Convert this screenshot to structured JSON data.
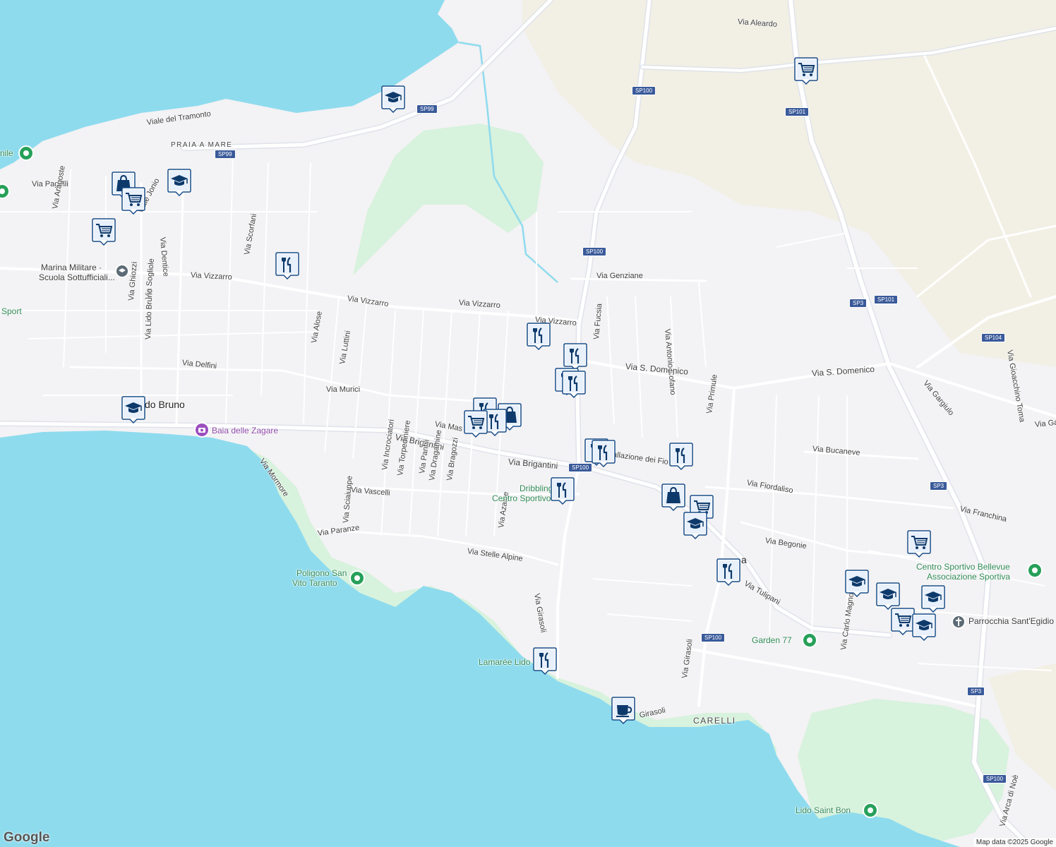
{
  "colors": {
    "land": "#f3f2f4",
    "water": "#8edbee",
    "park": "#d7f2dd",
    "farmland": "#f2efe4",
    "road": "#ffffff",
    "major_road": "#dfe3ea",
    "marker_fill": "#ffffff",
    "marker_border": "#1a4f8a",
    "marker_icon": "#0e3a6b",
    "poi_green": "#27a05a",
    "poi_purple": "#9b4fbf",
    "poi_gray": "#5d6b76"
  },
  "streets": {
    "via_aleardo": "Via Aleardo",
    "viale_del_tramonto": "Viale del Tramonto",
    "via_pagelli": "Via Pagelli",
    "via_aragoste": "Via Aragoste",
    "viale_jonio": "Viale Jonio",
    "via_dentice": "Via Dentice",
    "via_scorfani": "Via Scorfani",
    "via_vizzarro_1": "Via Vizzarro",
    "via_vizzarro_2": "Via Vizzarro",
    "via_vizzarro_3": "Via Vizzarro",
    "via_vizzarro_4": "Via Vizzarro",
    "via_ghiozzi": "Via Ghiozzi",
    "via_sogliole": "Via Sogliole",
    "via_lido_bruno": "Via Lido Bruno",
    "via_alose": "Via Alose",
    "via_luttini": "Via Luttini",
    "via_delfini": "Via Delfini",
    "via_murici": "Via Murici",
    "via_genziane": "Via Genziane",
    "via_fucsia": "Via Fucsia",
    "via_antonio_cofano": "Via Antonio Cofano",
    "via_s_domenico_1": "Via S. Domenico",
    "via_s_domenico_2": "Via S. Domenico",
    "via_primule": "Via Primule",
    "via_gargiulo": "Via Gargiulo",
    "via_gioacchino_toma": "Via Gioacchino Toma",
    "via_ga": "Via Ga",
    "via_bucaneve": "Via Bucaneve",
    "via_mas": "Via Mas",
    "via_brigantini_1": "Via Brigantini",
    "via_brigantini_2": "Via Brigantini",
    "vallazione_dei_fio": "allazione dei Fio",
    "via_fiordaliso": "Via Fiordaliso",
    "via_franchina": "Via Franchina",
    "via_mormore": "Via Mormore",
    "via_incrociatori": "Via Incrociatori",
    "via_torpediniere": "Via Torpediniere",
    "via_panfili": "Via Panfili",
    "via_dragamine": "Via Dragamine",
    "via_bragozzi": "Via Bragozzi",
    "via_vascelli": "Via Vascelli",
    "via_sciaiuppe": "Via Sciaiuppe",
    "via_paranze": "Via Paranze",
    "via_azalee": "Via Azalee",
    "via_stelle_alpine": "Via Stelle Alpine",
    "via_girasoli_1": "Via Girasoli",
    "via_girasoli_2": "Via Girasoli",
    "via_girasoli_3": "Girasoli",
    "via_begonie": "Via Begonie",
    "via_tulipani": "Via Tulipani",
    "via_carlo_magno": "Via Carlo Magno",
    "via_arca_di_noe": "Via Arca di Noè"
  },
  "areas": {
    "praia_a_mare": "PRAIA A MARE",
    "carelli": "CARELLI",
    "lido_bruno": "do Bruno",
    "a_suffix": "a"
  },
  "road_badges": [
    "SP100",
    "SP99",
    "SP99",
    "SP101",
    "SP100",
    "SP3",
    "SP101",
    "SP104",
    "SP100",
    "SP3",
    "SP100",
    "SP3",
    "SP100"
  ],
  "pois": {
    "marina_militare": "Marina Militare ·\nScuola Sottufficiali...",
    "marina_militare_line1": "Marina Militare ·",
    "marina_militare_line2": "Scuola Sottufficiali...",
    "sport": "Sport",
    "baia_delle_zagare": "Baia delle Zagare",
    "dribbling_1": "Dribbling",
    "dribbling_2": "Centro Sportivo",
    "poligono_1": "Poligono San",
    "poligono_2": "Vito Taranto",
    "lamaree": "Lamarée Lido",
    "centro_bellevue_1": "Centro Sportivo Bellevue",
    "centro_bellevue_2": "Associazione Sportiva",
    "parrocchia": "Parrocchia Sant'Egidio",
    "garden_77": "Garden 77",
    "lido_saint_bon": "Lido Saint Bon",
    "nile": "nile"
  },
  "markers": [
    {
      "icon": "school-icon"
    },
    {
      "icon": "shopping-cart-icon"
    },
    {
      "icon": "shopping-bag-icon"
    },
    {
      "icon": "shopping-cart-icon"
    },
    {
      "icon": "school-icon"
    },
    {
      "icon": "shopping-cart-icon"
    },
    {
      "icon": "restaurant-icon"
    },
    {
      "icon": "restaurant-icon"
    },
    {
      "icon": "restaurant-icon"
    },
    {
      "icon": "restaurant-icon"
    },
    {
      "icon": "restaurant-icon"
    },
    {
      "icon": "school-icon"
    },
    {
      "icon": "restaurant-icon"
    },
    {
      "icon": "shopping-bag-icon"
    },
    {
      "icon": "restaurant-icon"
    },
    {
      "icon": "shopping-cart-icon"
    },
    {
      "icon": "restaurant-icon"
    },
    {
      "icon": "restaurant-icon"
    },
    {
      "icon": "restaurant-icon"
    },
    {
      "icon": "restaurant-icon"
    },
    {
      "icon": "shopping-bag-icon"
    },
    {
      "icon": "shopping-cart-icon"
    },
    {
      "icon": "school-icon"
    },
    {
      "icon": "restaurant-icon"
    },
    {
      "icon": "shopping-cart-icon"
    },
    {
      "icon": "school-icon"
    },
    {
      "icon": "school-icon"
    },
    {
      "icon": "school-icon"
    },
    {
      "icon": "shopping-cart-icon"
    },
    {
      "icon": "school-icon"
    },
    {
      "icon": "restaurant-icon"
    },
    {
      "icon": "cafe-icon"
    }
  ],
  "branding": {
    "google": "Google",
    "attribution": "Map data ©2025 Google"
  }
}
